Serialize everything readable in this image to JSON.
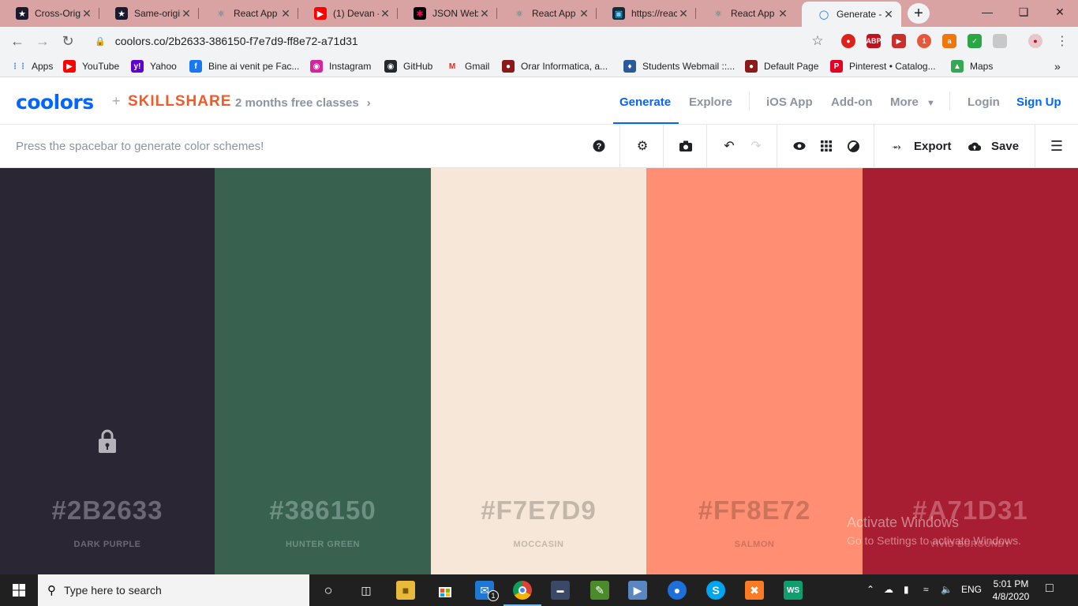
{
  "browser": {
    "tabs": [
      {
        "title": "Cross-Origi",
        "icon": "auth0-icon",
        "active": false
      },
      {
        "title": "Same-origir",
        "icon": "auth0-icon",
        "active": false
      },
      {
        "title": "React App",
        "icon": "react-icon",
        "active": false
      },
      {
        "title": "(1) Devan -",
        "icon": "youtube-icon",
        "active": false
      },
      {
        "title": "JSON Web",
        "icon": "jwt-icon",
        "active": false
      },
      {
        "title": "React App",
        "icon": "react-icon",
        "active": false
      },
      {
        "title": "https://reac",
        "icon": "site-icon",
        "active": false
      },
      {
        "title": "React App",
        "icon": "react-icon",
        "active": false
      },
      {
        "title": "Generate - C",
        "icon": "coolors-icon",
        "active": true
      }
    ],
    "url": "coolors.co/2b2633-386150-f7e7d9-ff8e72-a71d31",
    "bookmarks": [
      {
        "label": "Apps",
        "icon": "apps-grid-icon"
      },
      {
        "label": "YouTube",
        "icon": "youtube-icon"
      },
      {
        "label": "Yahoo",
        "icon": "yahoo-icon"
      },
      {
        "label": "Bine ai venit pe Fac...",
        "icon": "facebook-icon"
      },
      {
        "label": "Instagram",
        "icon": "instagram-icon"
      },
      {
        "label": "GitHub",
        "icon": "github-icon"
      },
      {
        "label": "Gmail",
        "icon": "gmail-icon"
      },
      {
        "label": "Orar Informatica, a...",
        "icon": "site-icon"
      },
      {
        "label": "Students Webmail ::...",
        "icon": "webmail-icon"
      },
      {
        "label": "Default Page",
        "icon": "site-icon"
      },
      {
        "label": "Pinterest • Catalog...",
        "icon": "pinterest-icon"
      },
      {
        "label": "Maps",
        "icon": "maps-icon"
      }
    ],
    "more_bookmarks": "»"
  },
  "header": {
    "logo": "coolors",
    "plus": "+",
    "partner": "SKILLSHARE",
    "promo": "2 months free classes",
    "nav": [
      "Generate",
      "Explore",
      "iOS App",
      "Add-on",
      "More",
      "Login",
      "Sign Up"
    ]
  },
  "subbar": {
    "hint": "Press the spacebar to generate color schemes!",
    "export_label": "Export",
    "save_label": "Save"
  },
  "palette": [
    {
      "hex": "#2B2633",
      "name": "DARK PURPLE",
      "color": "#2b2633",
      "text_color": "#6c6773",
      "locked": true
    },
    {
      "hex": "#386150",
      "name": "HUNTER GREEN",
      "color": "#386150",
      "text_color": "#6f8f82",
      "locked": false
    },
    {
      "hex": "#F7E7D9",
      "name": "MOCCASIN",
      "color": "#f7e7d9",
      "text_color": "#c3b6ab",
      "locked": false
    },
    {
      "hex": "#FF8E72",
      "name": "SALMON",
      "color": "#ff8e72",
      "text_color": "#cc735c",
      "locked": false
    },
    {
      "hex": "#A71D31",
      "name": "VIVID BURGUNDY",
      "color": "#a71d31",
      "text_color": "#c35a69",
      "locked": false
    }
  ],
  "watermark": {
    "line1": "Activate Windows",
    "line2": "Go to Settings to activate Windows."
  },
  "taskbar": {
    "search_placeholder": "Type here to search",
    "language": "ENG",
    "time": "5:01 PM",
    "date": "4/8/2020",
    "mail_badge": "1"
  }
}
